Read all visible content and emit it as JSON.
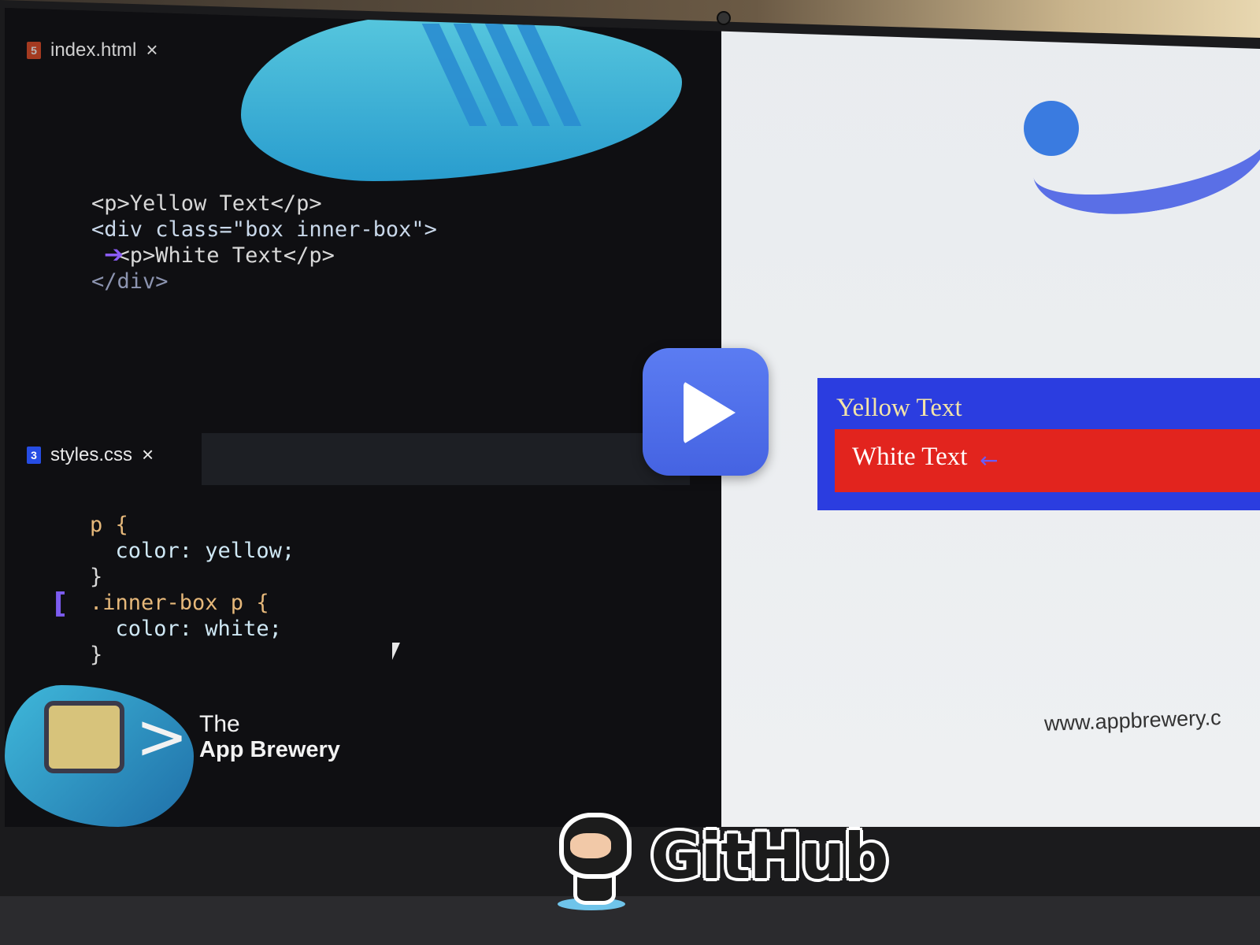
{
  "editor": {
    "html_tab": {
      "label": "index.html",
      "icon": "html5-file-icon",
      "close": "×"
    },
    "css_tab": {
      "label": "styles.css",
      "icon": "css3-file-icon",
      "close": "×"
    },
    "html_code": [
      "<p>Yellow Text</p>",
      "<div class=\"box inner-box\">",
      "  <p>White Text</p>",
      "</div>"
    ],
    "css_code": [
      "p {",
      "  color: yellow;",
      "}",
      ".inner-box p {",
      "  color: white;",
      "}"
    ]
  },
  "brand": {
    "line1": "The",
    "line2": "App Brewery",
    "chevron": ">"
  },
  "preview": {
    "outer_text": "Yellow Text",
    "inner_text": "White Text",
    "annotation_arrow": "←",
    "url": "www.appbrewery.c",
    "colors": {
      "outer_box": "#2b3de0",
      "inner_box": "#e2241e",
      "yellow_text": "#f3e4a8"
    }
  },
  "overlay": {
    "play_button": "play-icon"
  },
  "sticker": {
    "text": "GitHub",
    "mascot": "octocat-icon"
  }
}
